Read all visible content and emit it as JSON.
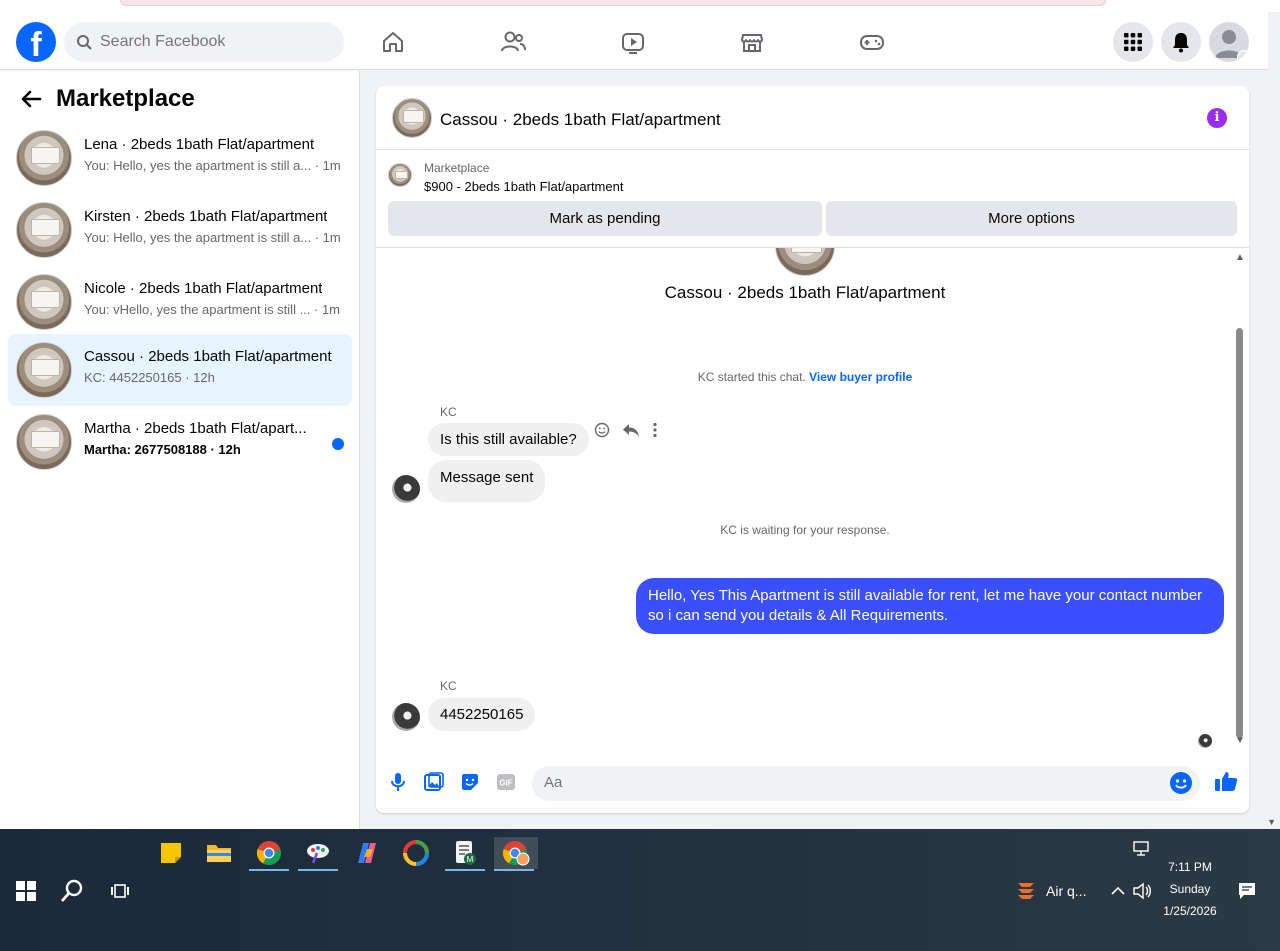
{
  "header": {
    "search_placeholder": "Search Facebook"
  },
  "sidebar": {
    "title": "Marketplace",
    "conversations": [
      {
        "name": "Lena · 2beds 1bath Flat/apartment",
        "snippet": "You: Hello, yes the apartment is still a... · 1m",
        "unread": false
      },
      {
        "name": "Kirsten · 2beds 1bath Flat/apartment",
        "snippet": "You: Hello, yes the apartment is still a... · 1m",
        "unread": false
      },
      {
        "name": "Nicole · 2beds 1bath Flat/apartment",
        "snippet": "You: vHello, yes the apartment is still ... · 1m",
        "unread": false
      },
      {
        "name": "Cassou · 2beds 1bath Flat/apartment",
        "snippet": "KC: 4452250165 · 12h",
        "unread": false
      },
      {
        "name": "Martha · 2beds 1bath Flat/apart...",
        "snippet": "Martha: 2677508188 · 12h",
        "unread": true
      }
    ]
  },
  "chat": {
    "title": "Cassou · 2beds 1bath Flat/apartment",
    "listing_label": "Marketplace",
    "listing_price": "$900 - 2beds 1bath Flat/apartment",
    "mark_pending": "Mark as pending",
    "more_options": "More options",
    "convo_title": "Cassou · 2beds 1bath Flat/apartment",
    "started": "KC started this chat.",
    "view_profile": "View buyer profile",
    "sender1": "KC",
    "msg1": "Is this still available?",
    "msg2": "Message sent",
    "waiting": "KC is waiting for your response.",
    "reply": "Hello, Yes This Apartment is still available for rent, let me have your contact number so i can send you details & All Requirements.",
    "sender2": "KC",
    "msg3": "4452250165",
    "composer_placeholder": "Aa"
  },
  "taskbar": {
    "weather": "Air q...",
    "time": "7:11 PM",
    "day": "Sunday",
    "date": "1/25/2026"
  },
  "colors": {
    "fb_blue": "#0866ff",
    "outgoing_bubble": "#3a50ff",
    "active_conversation": "#e7f3ff"
  }
}
